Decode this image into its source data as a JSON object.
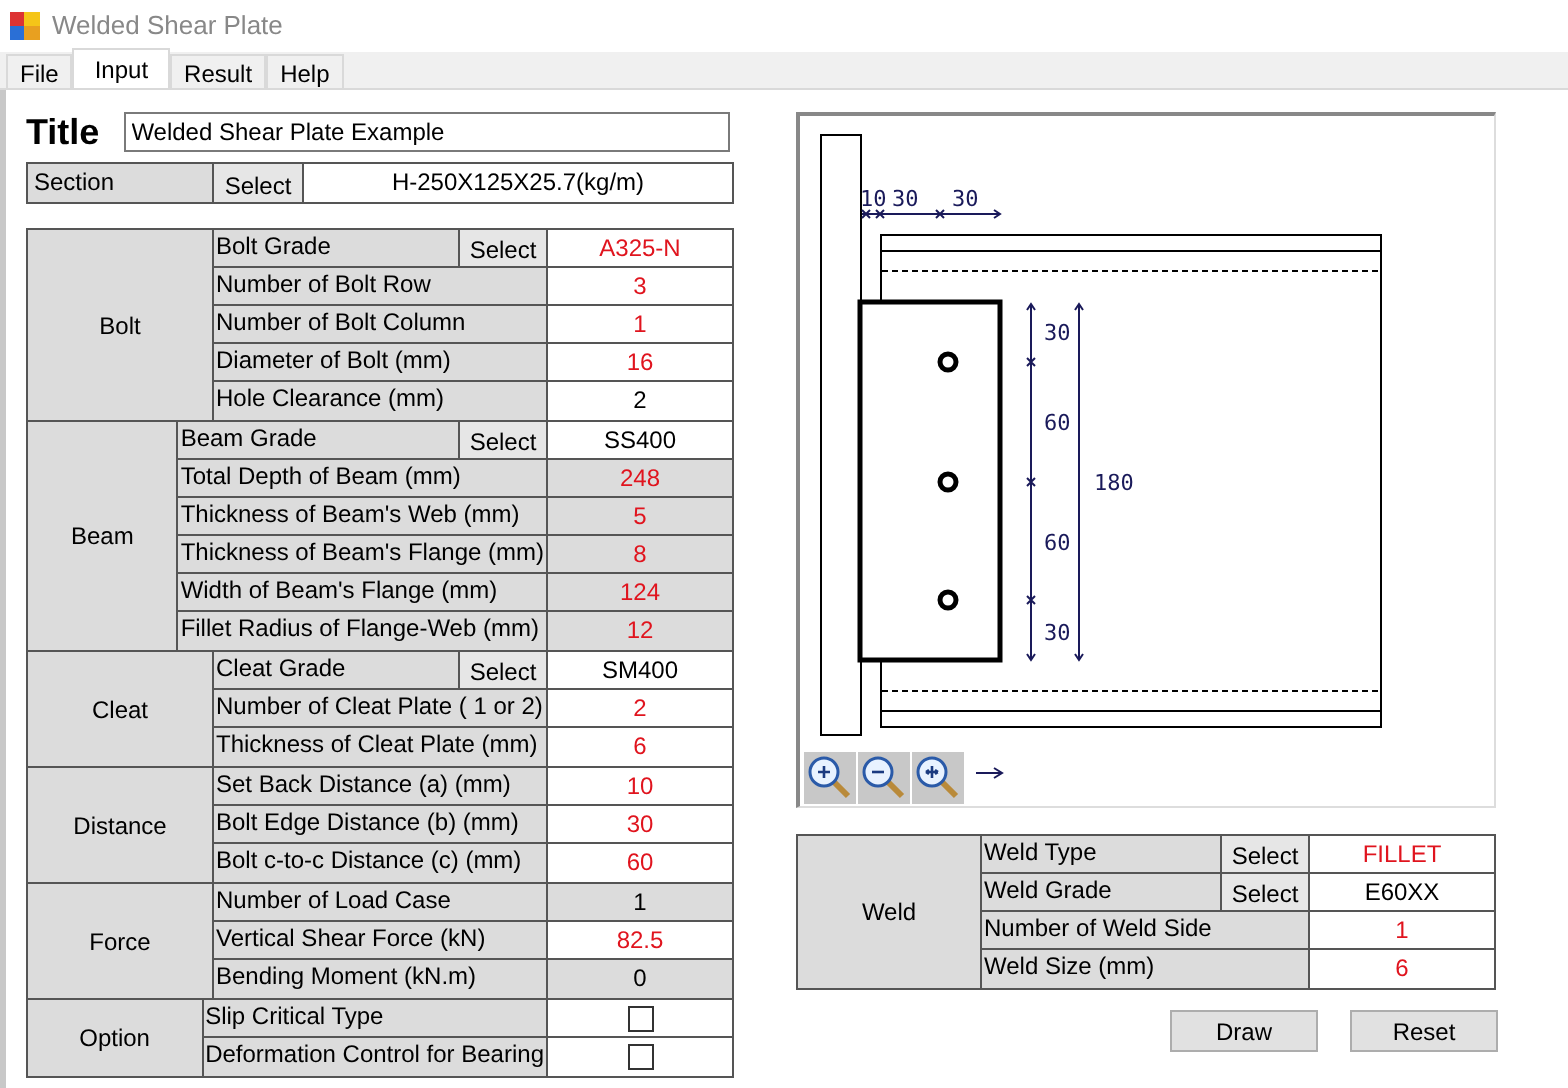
{
  "window": {
    "title": "Welded Shear Plate"
  },
  "tabs": [
    {
      "label": "File",
      "selected": false
    },
    {
      "label": "Input",
      "selected": true
    },
    {
      "label": "Result",
      "selected": false
    },
    {
      "label": "Help",
      "selected": false
    }
  ],
  "title_field": {
    "label": "Title",
    "value": "Welded Shear Plate Example"
  },
  "section": {
    "label": "Section",
    "button": "Select",
    "value": "H-250X125X25.7(kg/m)"
  },
  "groups": [
    {
      "name": "Bolt",
      "rows": [
        {
          "kind": "value",
          "label": "Bolt Grade",
          "button": "Select",
          "value": "A325-N",
          "changed": true,
          "readonly": false
        },
        {
          "kind": "value",
          "label": "Number of Bolt Row",
          "value": "3",
          "changed": true,
          "readonly": false
        },
        {
          "kind": "value",
          "label": "Number of Bolt Column",
          "value": "1",
          "changed": true,
          "readonly": false
        },
        {
          "kind": "value",
          "label": "Diameter of Bolt (mm)",
          "value": "16",
          "changed": true,
          "readonly": false
        },
        {
          "kind": "value",
          "label": "Hole Clearance (mm)",
          "value": "2",
          "changed": false,
          "readonly": false
        }
      ]
    },
    {
      "name": "Beam",
      "rows": [
        {
          "kind": "value",
          "label": "Beam Grade",
          "button": "Select",
          "value": "SS400",
          "changed": false,
          "readonly": false
        },
        {
          "kind": "value",
          "label": "Total Depth of Beam (mm)",
          "value": "248",
          "changed": true,
          "readonly": true
        },
        {
          "kind": "value",
          "label": "Thickness of Beam's Web (mm)",
          "value": "5",
          "changed": true,
          "readonly": true
        },
        {
          "kind": "value",
          "label": "Thickness of Beam's Flange (mm)",
          "value": "8",
          "changed": true,
          "readonly": true
        },
        {
          "kind": "value",
          "label": "Width of Beam's Flange (mm)",
          "value": "124",
          "changed": true,
          "readonly": true
        },
        {
          "kind": "value",
          "label": "Fillet Radius of Flange-Web (mm)",
          "value": "12",
          "changed": true,
          "readonly": true
        }
      ]
    },
    {
      "name": "Cleat",
      "rows": [
        {
          "kind": "value",
          "label": "Cleat Grade",
          "button": "Select",
          "value": "SM400",
          "changed": false,
          "readonly": false
        },
        {
          "kind": "value",
          "label": "Number of Cleat Plate ( 1 or 2)",
          "value": "2",
          "changed": true,
          "readonly": false
        },
        {
          "kind": "value",
          "label": "Thickness of Cleat Plate (mm)",
          "value": "6",
          "changed": true,
          "readonly": false
        }
      ]
    },
    {
      "name": "Distance",
      "rows": [
        {
          "kind": "value",
          "label": "Set Back Distance (a) (mm)",
          "value": "10",
          "changed": true,
          "readonly": false
        },
        {
          "kind": "value",
          "label": "Bolt Edge Distance (b) (mm)",
          "value": "30",
          "changed": true,
          "readonly": false
        },
        {
          "kind": "value",
          "label": "Bolt c-to-c Distance (c) (mm)",
          "value": "60",
          "changed": true,
          "readonly": false
        }
      ]
    },
    {
      "name": "Force",
      "rows": [
        {
          "kind": "value",
          "label": "Number of Load Case",
          "value": "1",
          "changed": false,
          "readonly": true
        },
        {
          "kind": "value",
          "label": "Vertical Shear Force (kN)",
          "value": "82.5",
          "changed": true,
          "readonly": false
        },
        {
          "kind": "value",
          "label": "Bending Moment (kN.m)",
          "value": "0",
          "changed": false,
          "readonly": true
        }
      ]
    },
    {
      "name": "Option",
      "rows": [
        {
          "kind": "checkbox",
          "label": "Slip Critical Type",
          "checked": false
        },
        {
          "kind": "checkbox",
          "label": "Deformation Control for Bearing",
          "checked": false
        }
      ]
    }
  ],
  "drawing": {
    "top_dimensions": [
      "10",
      "30",
      "30"
    ],
    "vertical_dimensions": [
      "30",
      "60",
      "60",
      "30"
    ],
    "total_dimension": "180"
  },
  "weld": {
    "name": "Weld",
    "rows": [
      {
        "kind": "value",
        "label": "Weld Type",
        "button": "Select",
        "value": "FILLET",
        "changed": true,
        "readonly": false
      },
      {
        "kind": "value",
        "label": "Weld Grade",
        "button": "Select",
        "value": "E60XX",
        "changed": false,
        "readonly": false
      },
      {
        "kind": "value",
        "label": "Number of Weld Side",
        "value": "1",
        "changed": true,
        "readonly": false
      },
      {
        "kind": "value",
        "label": "Weld Size (mm)",
        "value": "6",
        "changed": true,
        "readonly": false
      }
    ]
  },
  "buttons": [
    "Draw",
    "Reset"
  ]
}
